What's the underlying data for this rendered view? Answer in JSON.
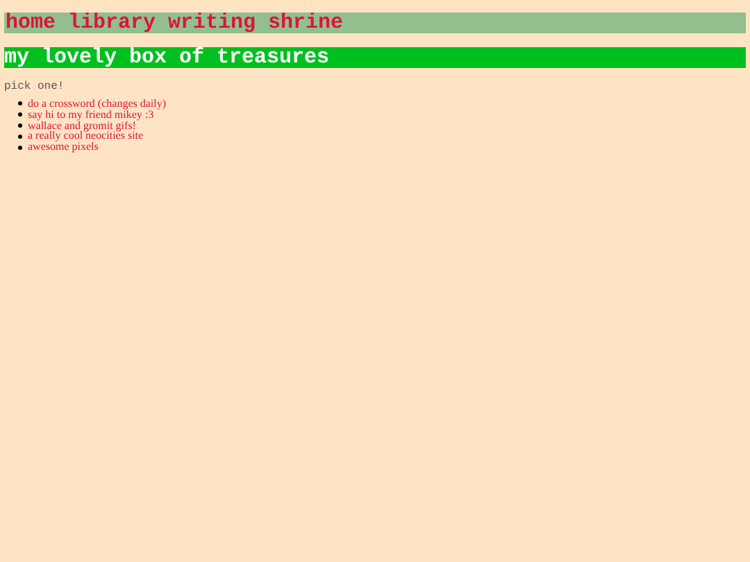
{
  "nav": {
    "links": [
      {
        "label": "home"
      },
      {
        "label": "library"
      },
      {
        "label": "writing"
      },
      {
        "label": "shrine"
      }
    ]
  },
  "heading": "my lovely box of treasures",
  "prompt": "pick one!",
  "links": [
    {
      "label": "do a crossword (changes daily)"
    },
    {
      "label": "say hi to my friend mikey :3"
    },
    {
      "label": "wallace and gromit gifs!"
    },
    {
      "label": "a really cool neocities site"
    },
    {
      "label": "awesome pixels"
    }
  ]
}
